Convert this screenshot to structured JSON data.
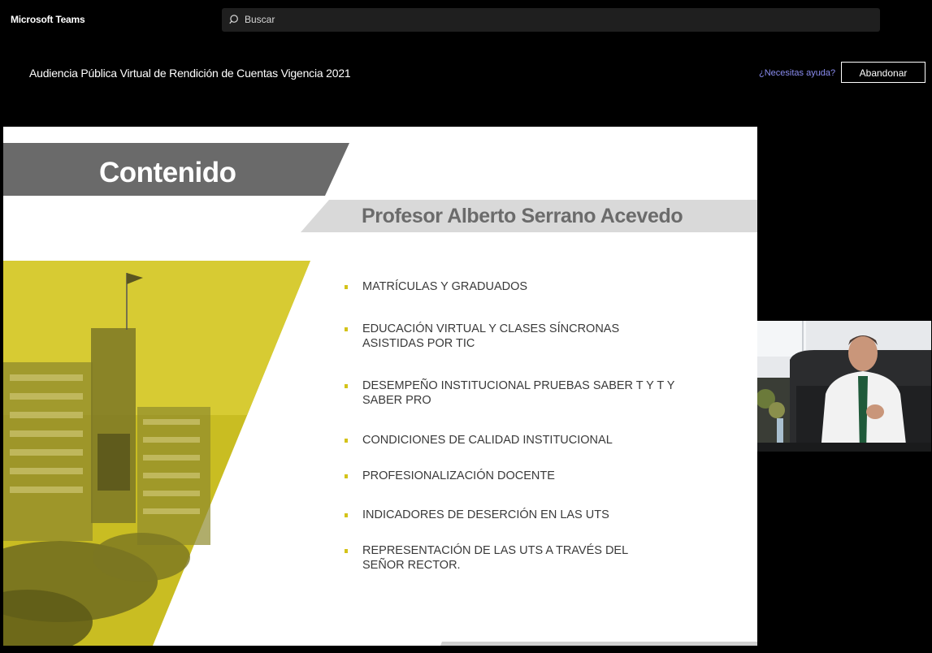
{
  "app": {
    "title": "Microsoft Teams"
  },
  "search": {
    "placeholder": "Buscar"
  },
  "meeting": {
    "title": "Audiencia Pública Virtual de Rendición de Cuentas Vigencia 2021",
    "help_link": "¿Necesitas ayuda?",
    "leave_label": "Abandonar"
  },
  "slide": {
    "title": "Contenido",
    "subtitle": "Profesor Alberto Serrano Acevedo",
    "topics": [
      "MATRÍCULAS Y GRADUADOS",
      "EDUCACIÓN VIRTUAL Y CLASES SÍNCRONAS ASISTIDAS POR TIC",
      "DESEMPEÑO INSTITUCIONAL PRUEBAS SABER T Y T Y SABER PRO",
      "CONDICIONES DE CALIDAD INSTITUCIONAL",
      "PROFESIONALIZACIÓN DOCENTE",
      "INDICADORES DE DESERCIÓN EN LAS UTS",
      "REPRESENTACIÓN DE LAS UTS A TRAVÉS DEL SEÑOR RECTOR."
    ]
  },
  "colors": {
    "accent_yellow": "#d4c31a",
    "title_band": "#6a6a6a",
    "subtitle_band": "#d9d9d9",
    "link": "#8a8cf0"
  }
}
